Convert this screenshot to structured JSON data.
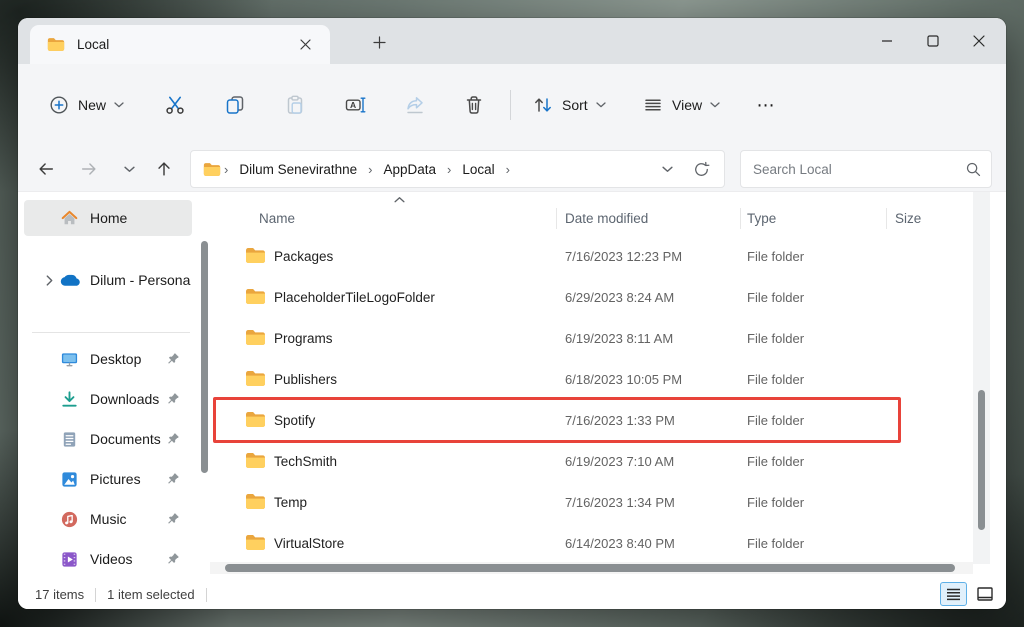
{
  "window": {
    "tab_title": "Local",
    "controls": {
      "minimize": "minimize",
      "maximize": "maximize",
      "close": "close"
    }
  },
  "toolbar": {
    "new_label": "New",
    "sort_label": "Sort",
    "view_label": "View",
    "more_label": "⋯"
  },
  "navbar": {
    "breadcrumbs": [
      "Dilum Senevirathne",
      "AppData",
      "Local"
    ],
    "crumb_sep": "›",
    "search_placeholder": "Search Local"
  },
  "sidebar": {
    "items": [
      {
        "label": "Home"
      },
      {
        "label": "Dilum - Persona"
      },
      {
        "label": "Desktop"
      },
      {
        "label": "Downloads"
      },
      {
        "label": "Documents"
      },
      {
        "label": "Pictures"
      },
      {
        "label": "Music"
      },
      {
        "label": "Videos"
      }
    ]
  },
  "filelist": {
    "columns": [
      "Name",
      "Date modified",
      "Type",
      "Size"
    ],
    "rows": [
      {
        "name": "Packages",
        "date": "7/16/2023 12:23 PM",
        "type": "File folder"
      },
      {
        "name": "PlaceholderTileLogoFolder",
        "date": "6/29/2023 8:24 AM",
        "type": "File folder"
      },
      {
        "name": "Programs",
        "date": "6/19/2023 8:11 AM",
        "type": "File folder"
      },
      {
        "name": "Publishers",
        "date": "6/18/2023 10:05 PM",
        "type": "File folder"
      },
      {
        "name": "Spotify",
        "date": "7/16/2023 1:33 PM",
        "type": "File folder",
        "highlighted": true
      },
      {
        "name": "TechSmith",
        "date": "6/19/2023 7:10 AM",
        "type": "File folder"
      },
      {
        "name": "Temp",
        "date": "7/16/2023 1:34 PM",
        "type": "File folder"
      },
      {
        "name": "VirtualStore",
        "date": "6/14/2023 8:40 PM",
        "type": "File folder"
      }
    ]
  },
  "statusbar": {
    "items_label": "17 items",
    "selected_label": "1 item selected"
  },
  "colors": {
    "accent_blue": "#1874c9",
    "folder_yellow": "#ffd05f",
    "highlight_red": "#e8433a",
    "view_active_border": "#5fb0e7"
  }
}
